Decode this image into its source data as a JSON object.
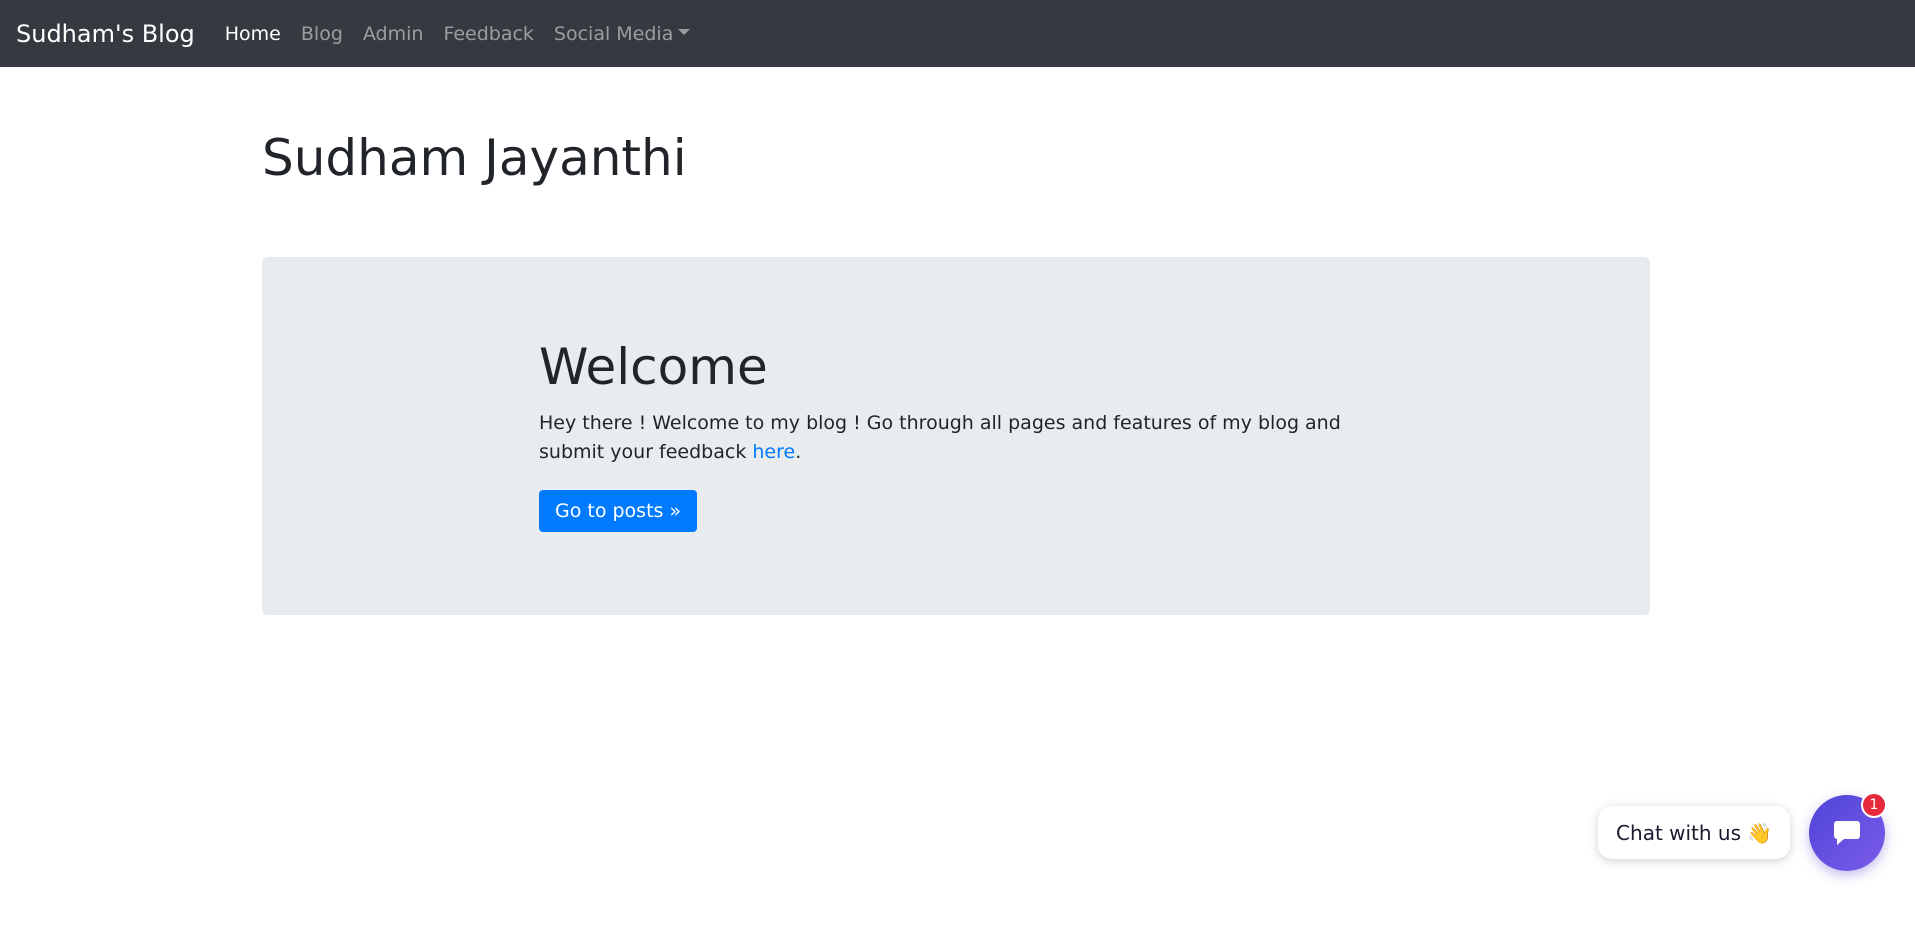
{
  "navbar": {
    "brand": "Sudham's Blog",
    "links": [
      {
        "label": "Home"
      },
      {
        "label": "Blog"
      },
      {
        "label": "Admin"
      },
      {
        "label": "Feedback"
      },
      {
        "label": "Social Media"
      }
    ]
  },
  "page": {
    "title": "Sudham Jayanthi"
  },
  "jumbotron": {
    "heading": "Welcome",
    "text_before_link": "Hey there ! Welcome to my blog ! Go through all pages and features of my blog and submit your feedback ",
    "link_text": "here",
    "text_after_link": ".",
    "button_label": "Go to posts »"
  },
  "chat": {
    "bubble_text": "Chat with us",
    "wave_emoji": "👋",
    "badge_count": "1",
    "launcher_icon": "chat-icon"
  },
  "colors": {
    "navbar_bg": "#343a40",
    "primary": "#007bff",
    "jumbotron_bg": "#e9ecef",
    "chat_gradient_start": "#4e44d8",
    "chat_gradient_end": "#7b5ce8",
    "badge": "#e52b3b"
  }
}
